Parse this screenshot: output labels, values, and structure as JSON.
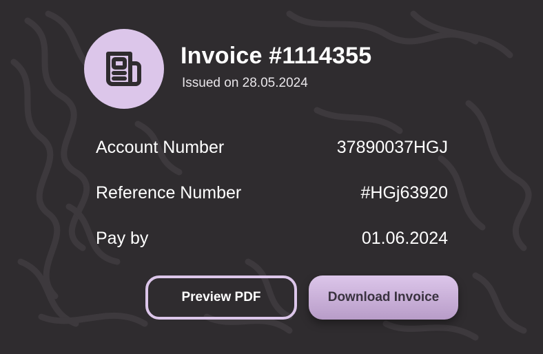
{
  "invoice": {
    "title": "Invoice #1114355",
    "issued": "Issued on 28.05.2024",
    "icon": "newspaper-icon"
  },
  "details": [
    {
      "label": "Account Number",
      "value": "37890037HGJ"
    },
    {
      "label": "Reference Number",
      "value": "#HGj63920"
    },
    {
      "label": "Pay by",
      "value": "01.06.2024"
    }
  ],
  "actions": {
    "preview_label": "Preview PDF",
    "download_label": "Download Invoice"
  },
  "colors": {
    "background": "#2f2c2f",
    "accent": "#dcc6ea",
    "text": "#ffffff"
  }
}
